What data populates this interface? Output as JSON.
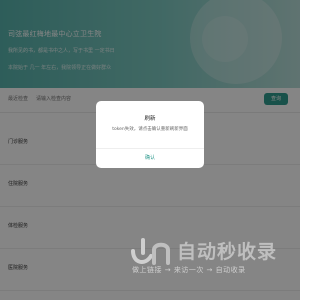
{
  "hero": {
    "title": "司弦最红梅地最中心立卫生院",
    "subtitle": "我所见的书，都是书中之人，写于书里 一定书日",
    "note": "本院始于 几一 年左右，我院领导正在做好群众"
  },
  "search": {
    "label": "最近检查",
    "placeholder": "请输入检查内容",
    "button_label": "查询"
  },
  "rows": [
    {
      "label": "门诊服务"
    },
    {
      "label": "住院服务"
    },
    {
      "label": "体检服务"
    },
    {
      "label": "医院服务"
    }
  ],
  "dialog": {
    "title": "刷新",
    "message": "token失效，请点击确认重新刷新界面",
    "confirm_label": "确认"
  },
  "watermark": {
    "main": "自动秒收录",
    "sub": "做上链接 → 来访一次 → 自动收录"
  },
  "colors": {
    "accent": "#2f9b8f",
    "overlay": "rgba(0,0,0,0.48)"
  }
}
